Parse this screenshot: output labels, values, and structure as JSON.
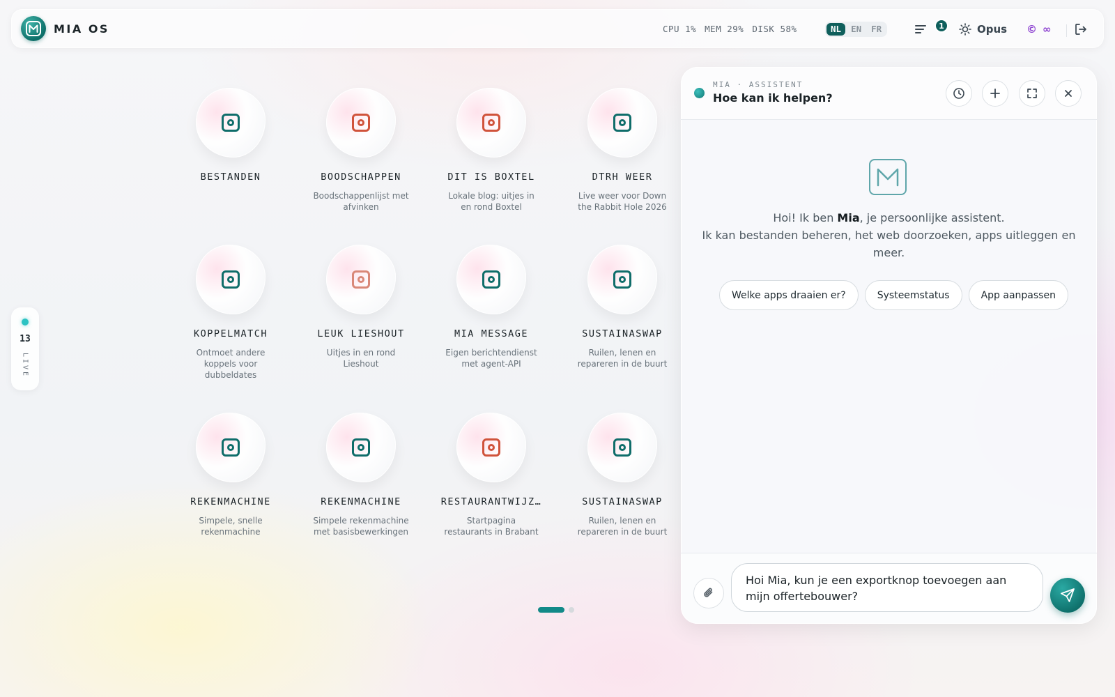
{
  "brand": {
    "name": "MIA OS"
  },
  "stats": {
    "cpu": "CPU 1%",
    "mem": "MEM 29%",
    "disk": "DISK 58%"
  },
  "languages": [
    "NL",
    "EN",
    "FR"
  ],
  "active_language": "NL",
  "notifications": {
    "count": "1"
  },
  "model": {
    "label": "Opus"
  },
  "credits": {
    "symbol": "©",
    "value": "∞"
  },
  "live": {
    "count": "13",
    "label": "LIVE"
  },
  "apps": [
    {
      "name": "BESTANDEN",
      "desc": "",
      "color": "teal"
    },
    {
      "name": "BOODSCHAPPEN",
      "desc": "Boodschappenlijst met afvinken",
      "color": "red"
    },
    {
      "name": "DIT IS BOXTEL",
      "desc": "Lokale blog: uitjes in en rond Boxtel",
      "color": "red"
    },
    {
      "name": "DTRH WEER",
      "desc": "Live weer voor Down the Rabbit Hole 2026",
      "color": "teal"
    },
    {
      "name": "KOPPELMATCH",
      "desc": "Ontmoet andere koppels voor dubbeldates",
      "color": "teal"
    },
    {
      "name": "LEUK LIESHOUT",
      "desc": "Uitjes in en rond Lieshout",
      "color": "pink"
    },
    {
      "name": "MIA MESSAGE",
      "desc": "Eigen berichtendienst met agent-API",
      "color": "teal"
    },
    {
      "name": "SUSTAINASWAP",
      "desc": "Ruilen, lenen en repareren in de buurt",
      "color": "teal"
    },
    {
      "name": "REKENMACHINE",
      "desc": "Simpele, snelle rekenmachine",
      "color": "teal"
    },
    {
      "name": "REKENMACHINE",
      "desc": "Simpele rekenmachine met basisbewerkingen",
      "color": "teal"
    },
    {
      "name": "RESTAURANTWIJZ…",
      "desc": "Startpagina restaurants in Brabant",
      "color": "red"
    },
    {
      "name": "SUSTAINASWAP",
      "desc": "Ruilen, lenen en repareren in de buurt",
      "color": "teal"
    }
  ],
  "pager": {
    "pages": 2,
    "current": 1
  },
  "chat": {
    "kicker": "MIA · ASSISTENT",
    "title": "Hoe kan ik helpen?",
    "greeting_prefix": "Hoi! Ik ben ",
    "greeting_name": "Mia",
    "greeting_suffix": ", je persoonlijke assistent.",
    "greeting_line2": "Ik kan bestanden beheren, het web doorzoeken, apps uitleggen en meer.",
    "suggestions": [
      "Welke apps draaien er?",
      "Systeemstatus",
      "App aanpassen"
    ],
    "input_value": "Hoi Mia, kun je een exportknop toevoegen aan mijn offertebouwer?"
  },
  "colors": {
    "accent": "#0f5f5c",
    "accent_light": "#2cc3c3",
    "credits": "#8b3fd0",
    "icon_red": "#d0533b"
  },
  "icons": {
    "history": "clock-icon",
    "new_chat": "plus-icon",
    "fullscreen": "expand-icon",
    "close": "close-icon",
    "attach": "paperclip-icon",
    "send": "send-icon",
    "notifications": "list-icon",
    "theme": "sun-icon",
    "logout": "logout-icon"
  }
}
